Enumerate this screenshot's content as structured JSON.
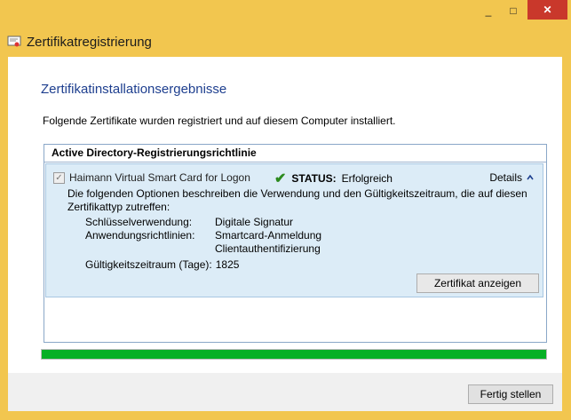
{
  "window": {
    "title": "Zertifikatregistrierung",
    "caption": {
      "minimize": "_",
      "maximize": "□",
      "close": "✕"
    }
  },
  "main": {
    "section_title": "Zertifikatinstallationsergebnisse",
    "intro": "Folgende Zertifikate wurden registriert und auf diesem Computer installiert."
  },
  "policy": {
    "header": "Active Directory-Registrierungsrichtlinie",
    "cert_name": "Haimann Virtual Smart Card for Logon",
    "status_label": "STATUS:",
    "status_value": "Erfolgreich",
    "details_label": "Details",
    "description_line1": "Die folgenden Optionen beschreiben die Verwendung und den Gültigkeitszeitraum, die auf diesen",
    "description_line2": "Zertifikattyp zutreffen:",
    "key_usage_label": "Schlüsselverwendung:",
    "key_usage_value": "Digitale Signatur",
    "app_policies_label": "Anwendungsrichtlinien:",
    "app_policies_values": [
      "Smartcard-Anmeldung",
      "Clientauthentifizierung"
    ],
    "validity_label": "Gültigkeitszeitraum (Tage):",
    "validity_value": "1825",
    "view_button": "Zertifikat anzeigen"
  },
  "progress": {
    "value": 1.0
  },
  "footer": {
    "finish_button": "Fertig stellen"
  },
  "colors": {
    "accent": "#1e3f8f",
    "progress": "#06b025",
    "window_frame": "#f2c64f",
    "close": "#c9382b"
  }
}
